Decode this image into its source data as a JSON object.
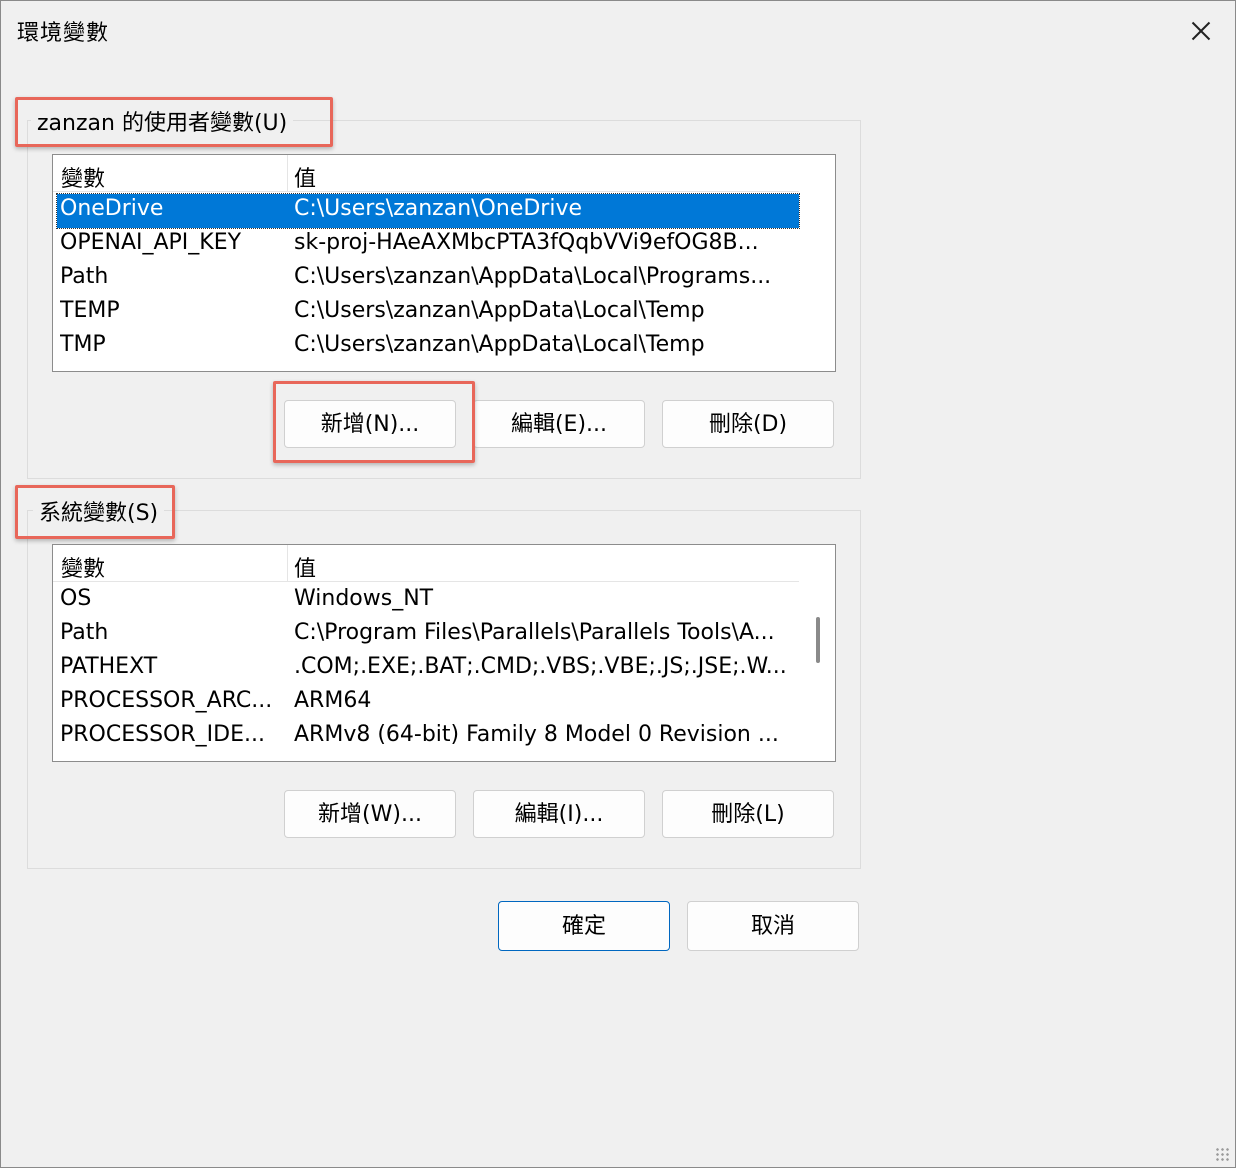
{
  "window": {
    "title": "環境變數"
  },
  "user_vars": {
    "group_label": "zanzan 的使用者變數(U)",
    "columns": [
      "變數",
      "值"
    ],
    "rows": [
      {
        "name": "OneDrive",
        "value": "C:\\Users\\zanzan\\OneDrive"
      },
      {
        "name": "OPENAI_API_KEY",
        "value": "sk-proj-HAeAXMbcPTA3fQqbVVi9efOG8B..."
      },
      {
        "name": "Path",
        "value": "C:\\Users\\zanzan\\AppData\\Local\\Programs..."
      },
      {
        "name": "TEMP",
        "value": "C:\\Users\\zanzan\\AppData\\Local\\Temp"
      },
      {
        "name": "TMP",
        "value": "C:\\Users\\zanzan\\AppData\\Local\\Temp"
      }
    ],
    "selected_row": "OneDrive",
    "buttons": {
      "new": "新增(N)...",
      "edit": "編輯(E)...",
      "delete": "刪除(D)"
    }
  },
  "system_vars": {
    "group_label": "系統變數(S)",
    "columns": [
      "變數",
      "值"
    ],
    "rows": [
      {
        "name": "OS",
        "value": "Windows_NT"
      },
      {
        "name": "Path",
        "value": "C:\\Program Files\\Parallels\\Parallels Tools\\A..."
      },
      {
        "name": "PATHEXT",
        "value": ".COM;.EXE;.BAT;.CMD;.VBS;.VBE;.JS;.JSE;.W..."
      },
      {
        "name": "PROCESSOR_ARC...",
        "value": "ARM64"
      },
      {
        "name": "PROCESSOR_IDE...",
        "value": "ARMv8 (64-bit) Family 8 Model 0 Revision  ..."
      }
    ],
    "buttons": {
      "new": "新增(W)...",
      "edit": "編輯(I)...",
      "delete": "刪除(L)"
    }
  },
  "footer": {
    "ok": "確定",
    "cancel": "取消"
  },
  "colors": {
    "highlight": "#e8675a",
    "selection": "#0078d7",
    "primary_border": "#0067c0"
  }
}
